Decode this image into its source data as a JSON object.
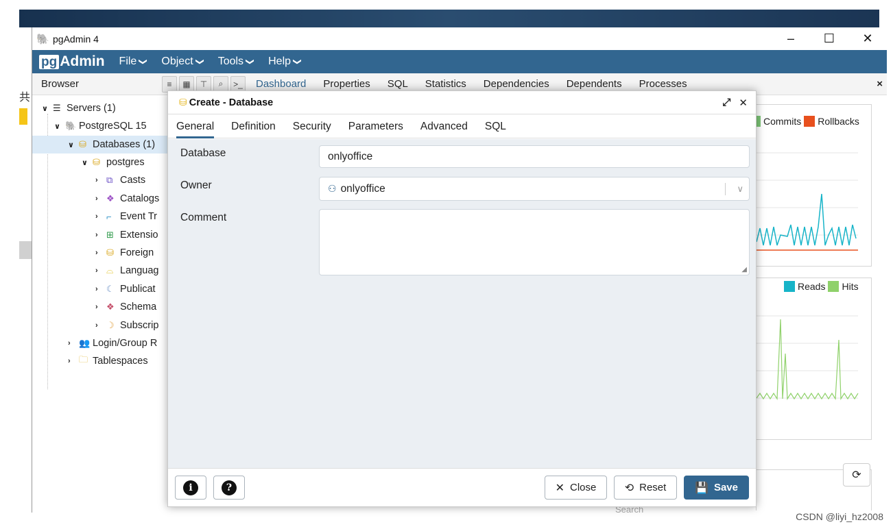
{
  "window": {
    "title": "pgAdmin 4",
    "controls": [
      "–",
      "☐",
      "✕"
    ]
  },
  "logo": {
    "pg": "pg",
    "admin": "Admin"
  },
  "menu": [
    {
      "label": "File"
    },
    {
      "label": "Object"
    },
    {
      "label": "Tools"
    },
    {
      "label": "Help"
    }
  ],
  "toolbar": {
    "browser_label": "Browser"
  },
  "main_tabs": [
    "Dashboard",
    "Properties",
    "SQL",
    "Statistics",
    "Dependencies",
    "Dependents",
    "Processes"
  ],
  "tree": {
    "servers": "Servers (1)",
    "server": "PostgreSQL 15",
    "databases": "Databases (1)",
    "postgres": "postgres",
    "children": [
      "Casts",
      "Catalogs",
      "Event Tr",
      "Extensio",
      "Foreign",
      "Languag",
      "Publicat",
      "Schema",
      "Subscrip"
    ],
    "login": "Login/Group R",
    "tablespaces": "Tablespaces"
  },
  "dashboard": {
    "legend1": [
      {
        "name": "Commits",
        "color": "#7cc576"
      },
      {
        "name": "Rollbacks",
        "color": "#e8501e"
      }
    ],
    "legend2": [
      {
        "name": "Reads",
        "color": "#17b4c8"
      },
      {
        "name": "Hits",
        "color": "#8fd16a"
      }
    ],
    "search_placeholder": "Search"
  },
  "dialog": {
    "title": "Create - Database",
    "tabs": [
      "General",
      "Definition",
      "Security",
      "Parameters",
      "Advanced",
      "SQL"
    ],
    "fields": {
      "database_label": "Database",
      "database_value": "onlyoffice",
      "owner_label": "Owner",
      "owner_value": "onlyoffice",
      "comment_label": "Comment",
      "comment_value": ""
    },
    "buttons": {
      "close": "Close",
      "reset": "Reset",
      "save": "Save"
    }
  },
  "watermark": "CSDN @liyi_hz2008",
  "colors": {
    "brand": "#326690",
    "selected_row": "#dbeaf7",
    "dialog_body": "#ebeff3"
  }
}
